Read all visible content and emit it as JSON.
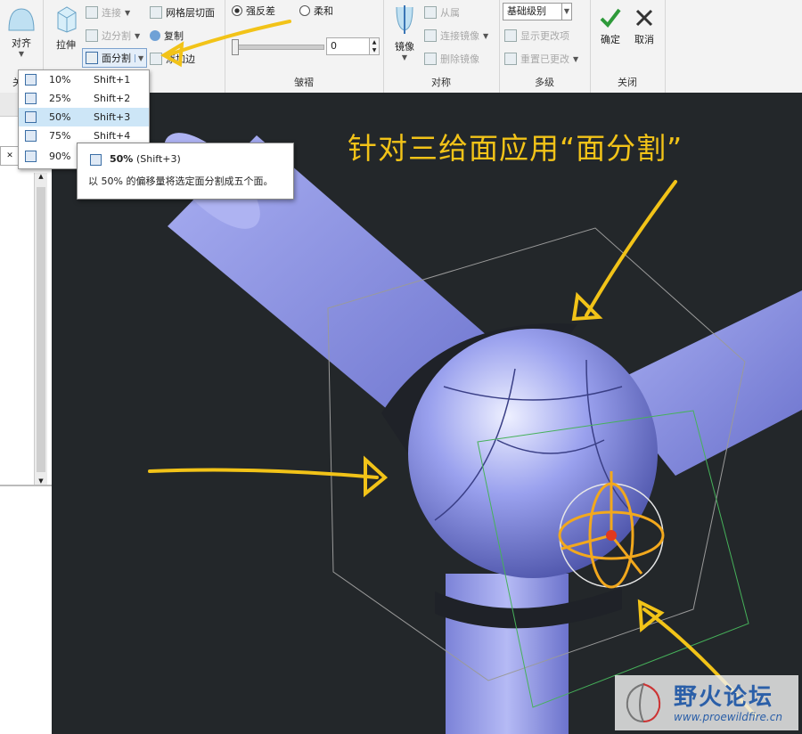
{
  "ribbon": {
    "align_group": {
      "align_label": "对齐",
      "label_partial": "关"
    },
    "extrude_label": "拉伸",
    "edit_rows": {
      "connect": "连接",
      "edge_split": "边分割",
      "face_split": "面分割",
      "mesh_face": "网格层切面",
      "copy": "复制",
      "add_edge": "添加边"
    },
    "crease": {
      "option_a": "强反差",
      "option_b": "柔和",
      "value": "0",
      "label": "皱褶"
    },
    "symmetry": {
      "mirror": "镜像",
      "slave": "从属",
      "connect_mirror": "连接镜像",
      "delete_mirror": "删除镜像",
      "label": "对称"
    },
    "multilevel": {
      "level_select": "基础级别",
      "show_changes": "显示更改项",
      "reset_changes": "重置已更改",
      "label": "多级"
    },
    "close": {
      "ok": "确定",
      "cancel": "取消",
      "label": "关闭"
    }
  },
  "dropdown": {
    "items": [
      {
        "pct": "10%",
        "shortcut": "Shift+1"
      },
      {
        "pct": "25%",
        "shortcut": "Shift+2"
      },
      {
        "pct": "50%",
        "shortcut": "Shift+3"
      },
      {
        "pct": "75%",
        "shortcut": "Shift+4"
      },
      {
        "pct": "90%",
        "shortcut": ""
      }
    ],
    "selected_index": 2
  },
  "tooltip": {
    "title": "50%",
    "shortcut": "(Shift+3)",
    "description": "以 50% 的偏移量将选定面分割成五个面。"
  },
  "annotation": {
    "caption": "针对三给面应用“面分割”"
  },
  "watermark": {
    "name": "野火论坛",
    "url": "www.proewildfire.cn"
  },
  "colors": {
    "annotation": "#f2c318",
    "model": "#8c93e6",
    "viewport": "#23272a",
    "selection": "#cde6f7"
  }
}
